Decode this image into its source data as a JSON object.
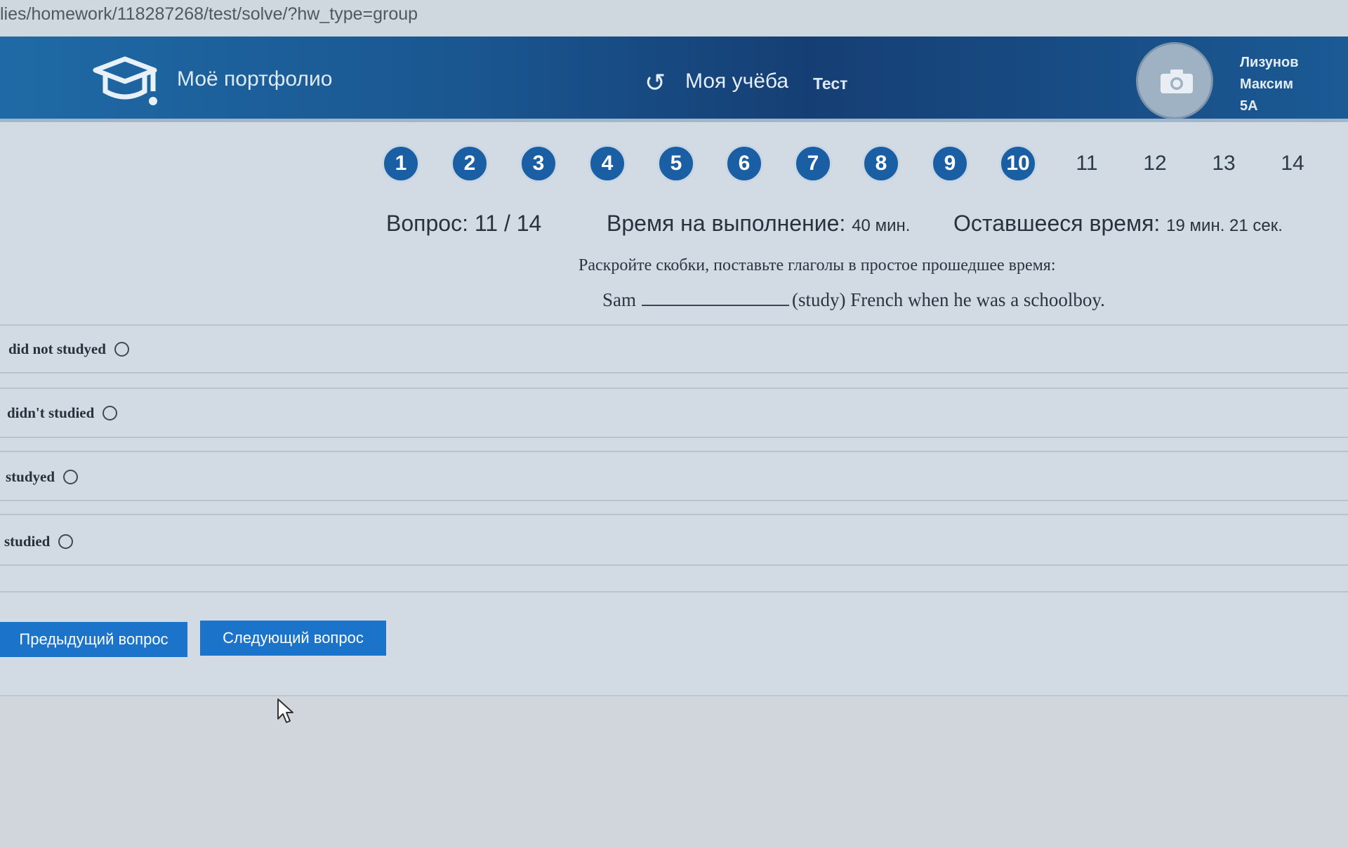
{
  "browser": {
    "url": "lies/homework/118287268/test/solve/?hw_type=group"
  },
  "header": {
    "brand": "Моё портфолио",
    "study_label": "Моя учёба",
    "test_label": "Тест",
    "user": {
      "last_name": "Лизунов",
      "first_name": "Максим",
      "class": "5А"
    },
    "icons": [
      "graduation-cap-icon",
      "refresh-icon",
      "camera-icon"
    ]
  },
  "question_nav": {
    "answered": [
      "1",
      "2",
      "3",
      "4",
      "5",
      "6",
      "7",
      "8",
      "9",
      "10"
    ],
    "unanswered": [
      "11",
      "12",
      "13",
      "14"
    ]
  },
  "status": {
    "question_label": "Вопрос: 11 / 14",
    "duration_label": "Время на выполнение:",
    "duration_value": "40 мин.",
    "remaining_label": "Оставшееся время:",
    "remaining_value": "19 мин. 21 сек."
  },
  "question": {
    "instruction": "Раскройте скобки, поставьте глаголы в простое прошедшее время:",
    "subject": "Sam",
    "rest": "(study) French when he was a schoolboy."
  },
  "options": [
    {
      "label": "did not studyed",
      "selected": false
    },
    {
      "label": "didn't studied",
      "selected": false
    },
    {
      "label": "studyed",
      "selected": false
    },
    {
      "label": "studied",
      "selected": false
    }
  ],
  "buttons": {
    "prev": "Предыдущий вопрос",
    "next": "Следующий вопрос"
  },
  "colors": {
    "header_dark": "#153f74",
    "header_light": "#1f6aa6",
    "nav_circle": "#1a5fa3",
    "button": "#1b74c9",
    "page_bg": "#d2dbe4"
  }
}
